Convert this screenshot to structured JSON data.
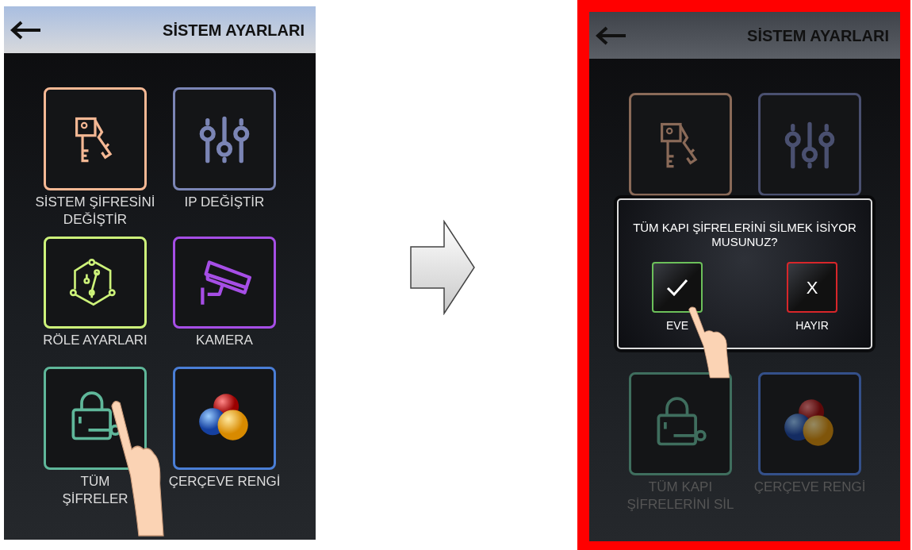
{
  "screens": [
    {
      "title": "SİSTEM AYARLARI",
      "highlighted": false,
      "dimmed": false,
      "tiles": [
        {
          "kind": "keys",
          "color": "#f5b894",
          "label_lines": [
            "SİSTEM ŞİFRESİNİ",
            "DEĞİŞTİR"
          ]
        },
        {
          "kind": "sliders",
          "color": "#7b85b5",
          "label_lines": [
            "IP DEĞİŞTİR"
          ]
        },
        {
          "kind": "circuit",
          "color": "#cdf27a",
          "label_lines": [
            "RÖLE AYARLARI"
          ]
        },
        {
          "kind": "camera",
          "color": "#a64ee6",
          "label_lines": [
            "KAMERA"
          ]
        },
        {
          "kind": "lock",
          "color": "#5fb79a",
          "label_lines": [
            "TÜM",
            "ŞİFRELER"
          ]
        },
        {
          "kind": "balls",
          "color": "#4a7ed6",
          "label_lines": [
            "ÇERÇEVE RENGİ"
          ]
        }
      ]
    },
    {
      "title": "SİSTEM AYARLARI",
      "highlighted": true,
      "dimmed": true,
      "tiles": [
        {
          "kind": "keys",
          "color": "#8a6a58"
        },
        {
          "kind": "sliders",
          "color": "#4a5070"
        },
        {
          "kind": "hidden"
        },
        {
          "kind": "hidden"
        },
        {
          "kind": "lock",
          "color": "#3f6e5e",
          "label_lines": [
            "TÜM KAPI",
            "ŞİFRELERİNİ SİL"
          ]
        },
        {
          "kind": "balls",
          "color": "#34508a",
          "label_lines": [
            "ÇERÇEVE RENGİ"
          ]
        }
      ],
      "dialog": {
        "message": "TÜM KAPI ŞİFRELERİNİ SİLMEK İSİYOR MUSUNUZ?",
        "buttons": [
          {
            "kind": "confirm",
            "color": "#6cc05a",
            "label": "EVE"
          },
          {
            "kind": "cancel",
            "color": "#d8262a",
            "glyph": "X",
            "label": "HAYIR"
          }
        ]
      }
    }
  ]
}
